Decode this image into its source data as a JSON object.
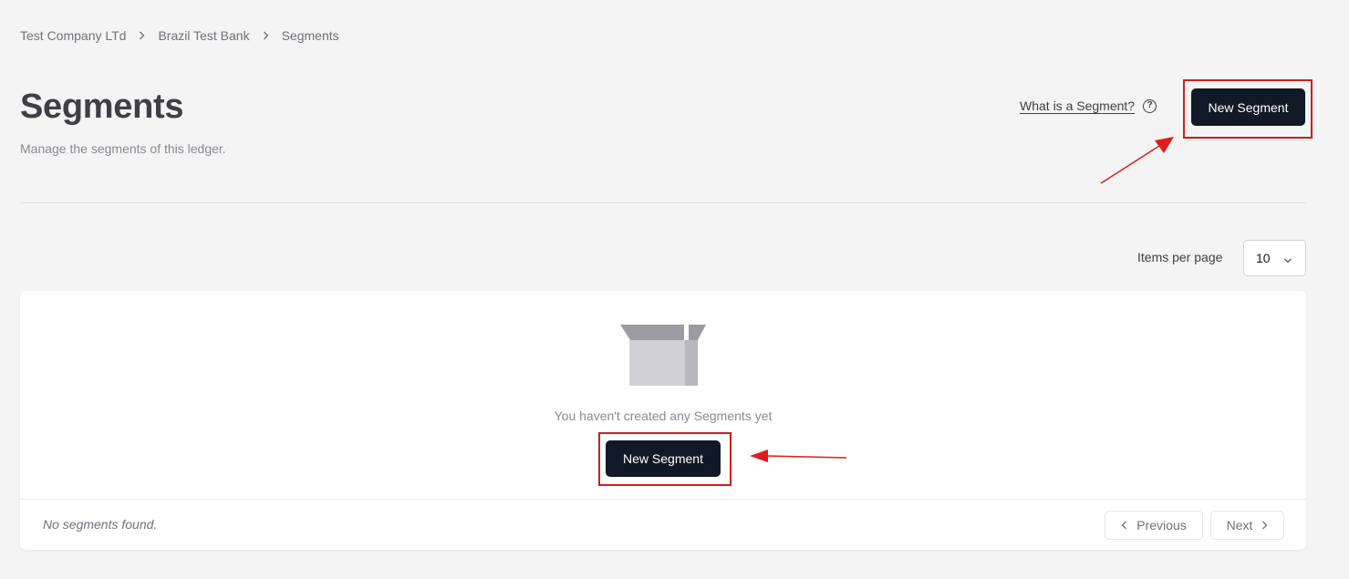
{
  "breadcrumb": {
    "items": [
      "Test Company LTd",
      "Brazil Test Bank",
      "Segments"
    ]
  },
  "header": {
    "title": "Segments",
    "subtitle": "Manage the segments of this ledger.",
    "help_link": "What is a Segment?",
    "new_button": "New Segment"
  },
  "pagination_controls": {
    "items_per_page_label": "Items per page",
    "items_per_page_value": "10"
  },
  "empty_state": {
    "message": "You haven't created any Segments yet",
    "new_button": "New Segment"
  },
  "footer": {
    "status": "No segments found.",
    "previous_label": "Previous",
    "next_label": "Next"
  },
  "colors": {
    "primary_button": "#111827",
    "annotation": "#cc1f1f",
    "background": "#f4f4f4"
  },
  "icons": [
    "chevron-right-icon",
    "help-circle-icon",
    "chevron-down-icon",
    "empty-box-icon",
    "chevron-left-icon"
  ]
}
